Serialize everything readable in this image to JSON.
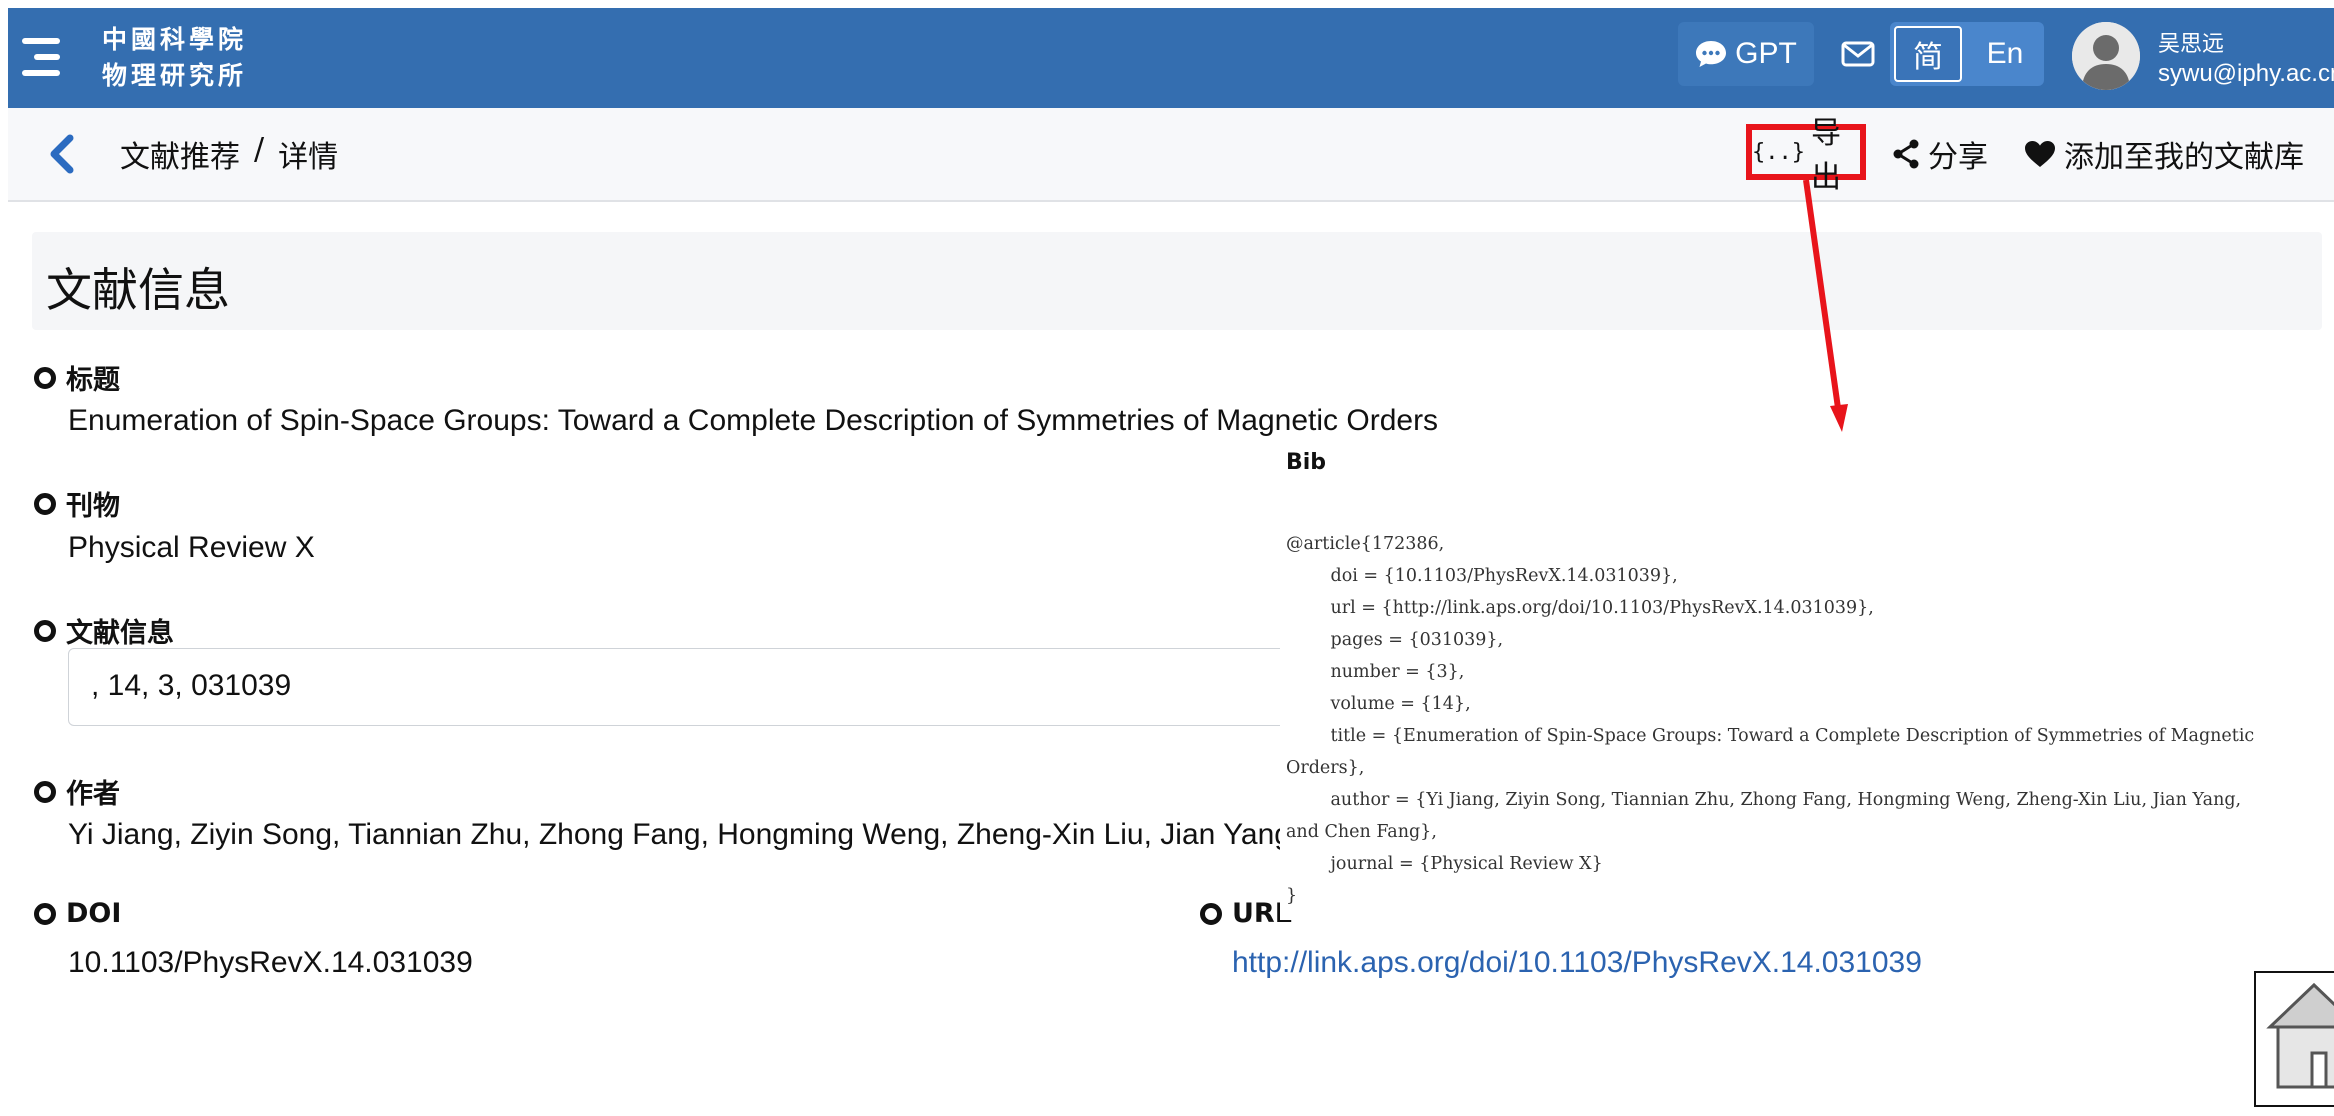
{
  "header": {
    "logo_line1": "中國科學院",
    "logo_line2": "物理研究所",
    "gpt_label": "GPT",
    "lang_zh": "简",
    "lang_en": "En",
    "user_name": "吴思远",
    "user_email": "sywu@iphy.ac.cn",
    "bar_color": "#346eb0"
  },
  "subheader": {
    "breadcrumb_parent": "文献推荐",
    "breadcrumb_sep": "/",
    "breadcrumb_current": "详情",
    "export_icon_text": "{..}",
    "export_label": "导出",
    "share_label": "分享",
    "add_label": "添加至我的文献库",
    "highlight_color": "#e8141b"
  },
  "section": {
    "title": "文献信息"
  },
  "fields": {
    "title_label": "标题",
    "title_value": "Enumeration of Spin-Space Groups: Toward a Complete Description of Symmetries of Magnetic Orders",
    "journal_label": "刊物",
    "journal_value": "Physical Review X",
    "info_label": "文献信息",
    "info_value": ", 14, 3, 031039",
    "authors_label": "作者",
    "authors_value": "Yi Jiang, Ziyin Song, Tiannian Zhu, Zhong Fang, Hongming Weng, Zheng-Xin Liu, Jian Yang",
    "doi_label": "DOI",
    "doi_value": "10.1103/PhysRevX.14.031039",
    "url_label": "URL",
    "url_value": "http://link.aps.org/doi/10.1103/PhysRevX.14.031039"
  },
  "bib": {
    "title": "Bib",
    "content": "@article{172386,\n        doi = {10.1103/PhysRevX.14.031039},\n        url = {http://link.aps.org/doi/10.1103/PhysRevX.14.031039},\n        pages = {031039},\n        number = {3},\n        volume = {14},\n        title = {Enumeration of Spin-Space Groups: Toward a Complete Description of Symmetries of Magnetic\nOrders},\n        author = {Yi Jiang, Ziyin Song, Tiannian Zhu, Zhong Fang, Hongming Weng, Zheng-Xin Liu, Jian Yang,\nand Chen Fang},\n        journal = {Physical Review X}\n}"
  }
}
